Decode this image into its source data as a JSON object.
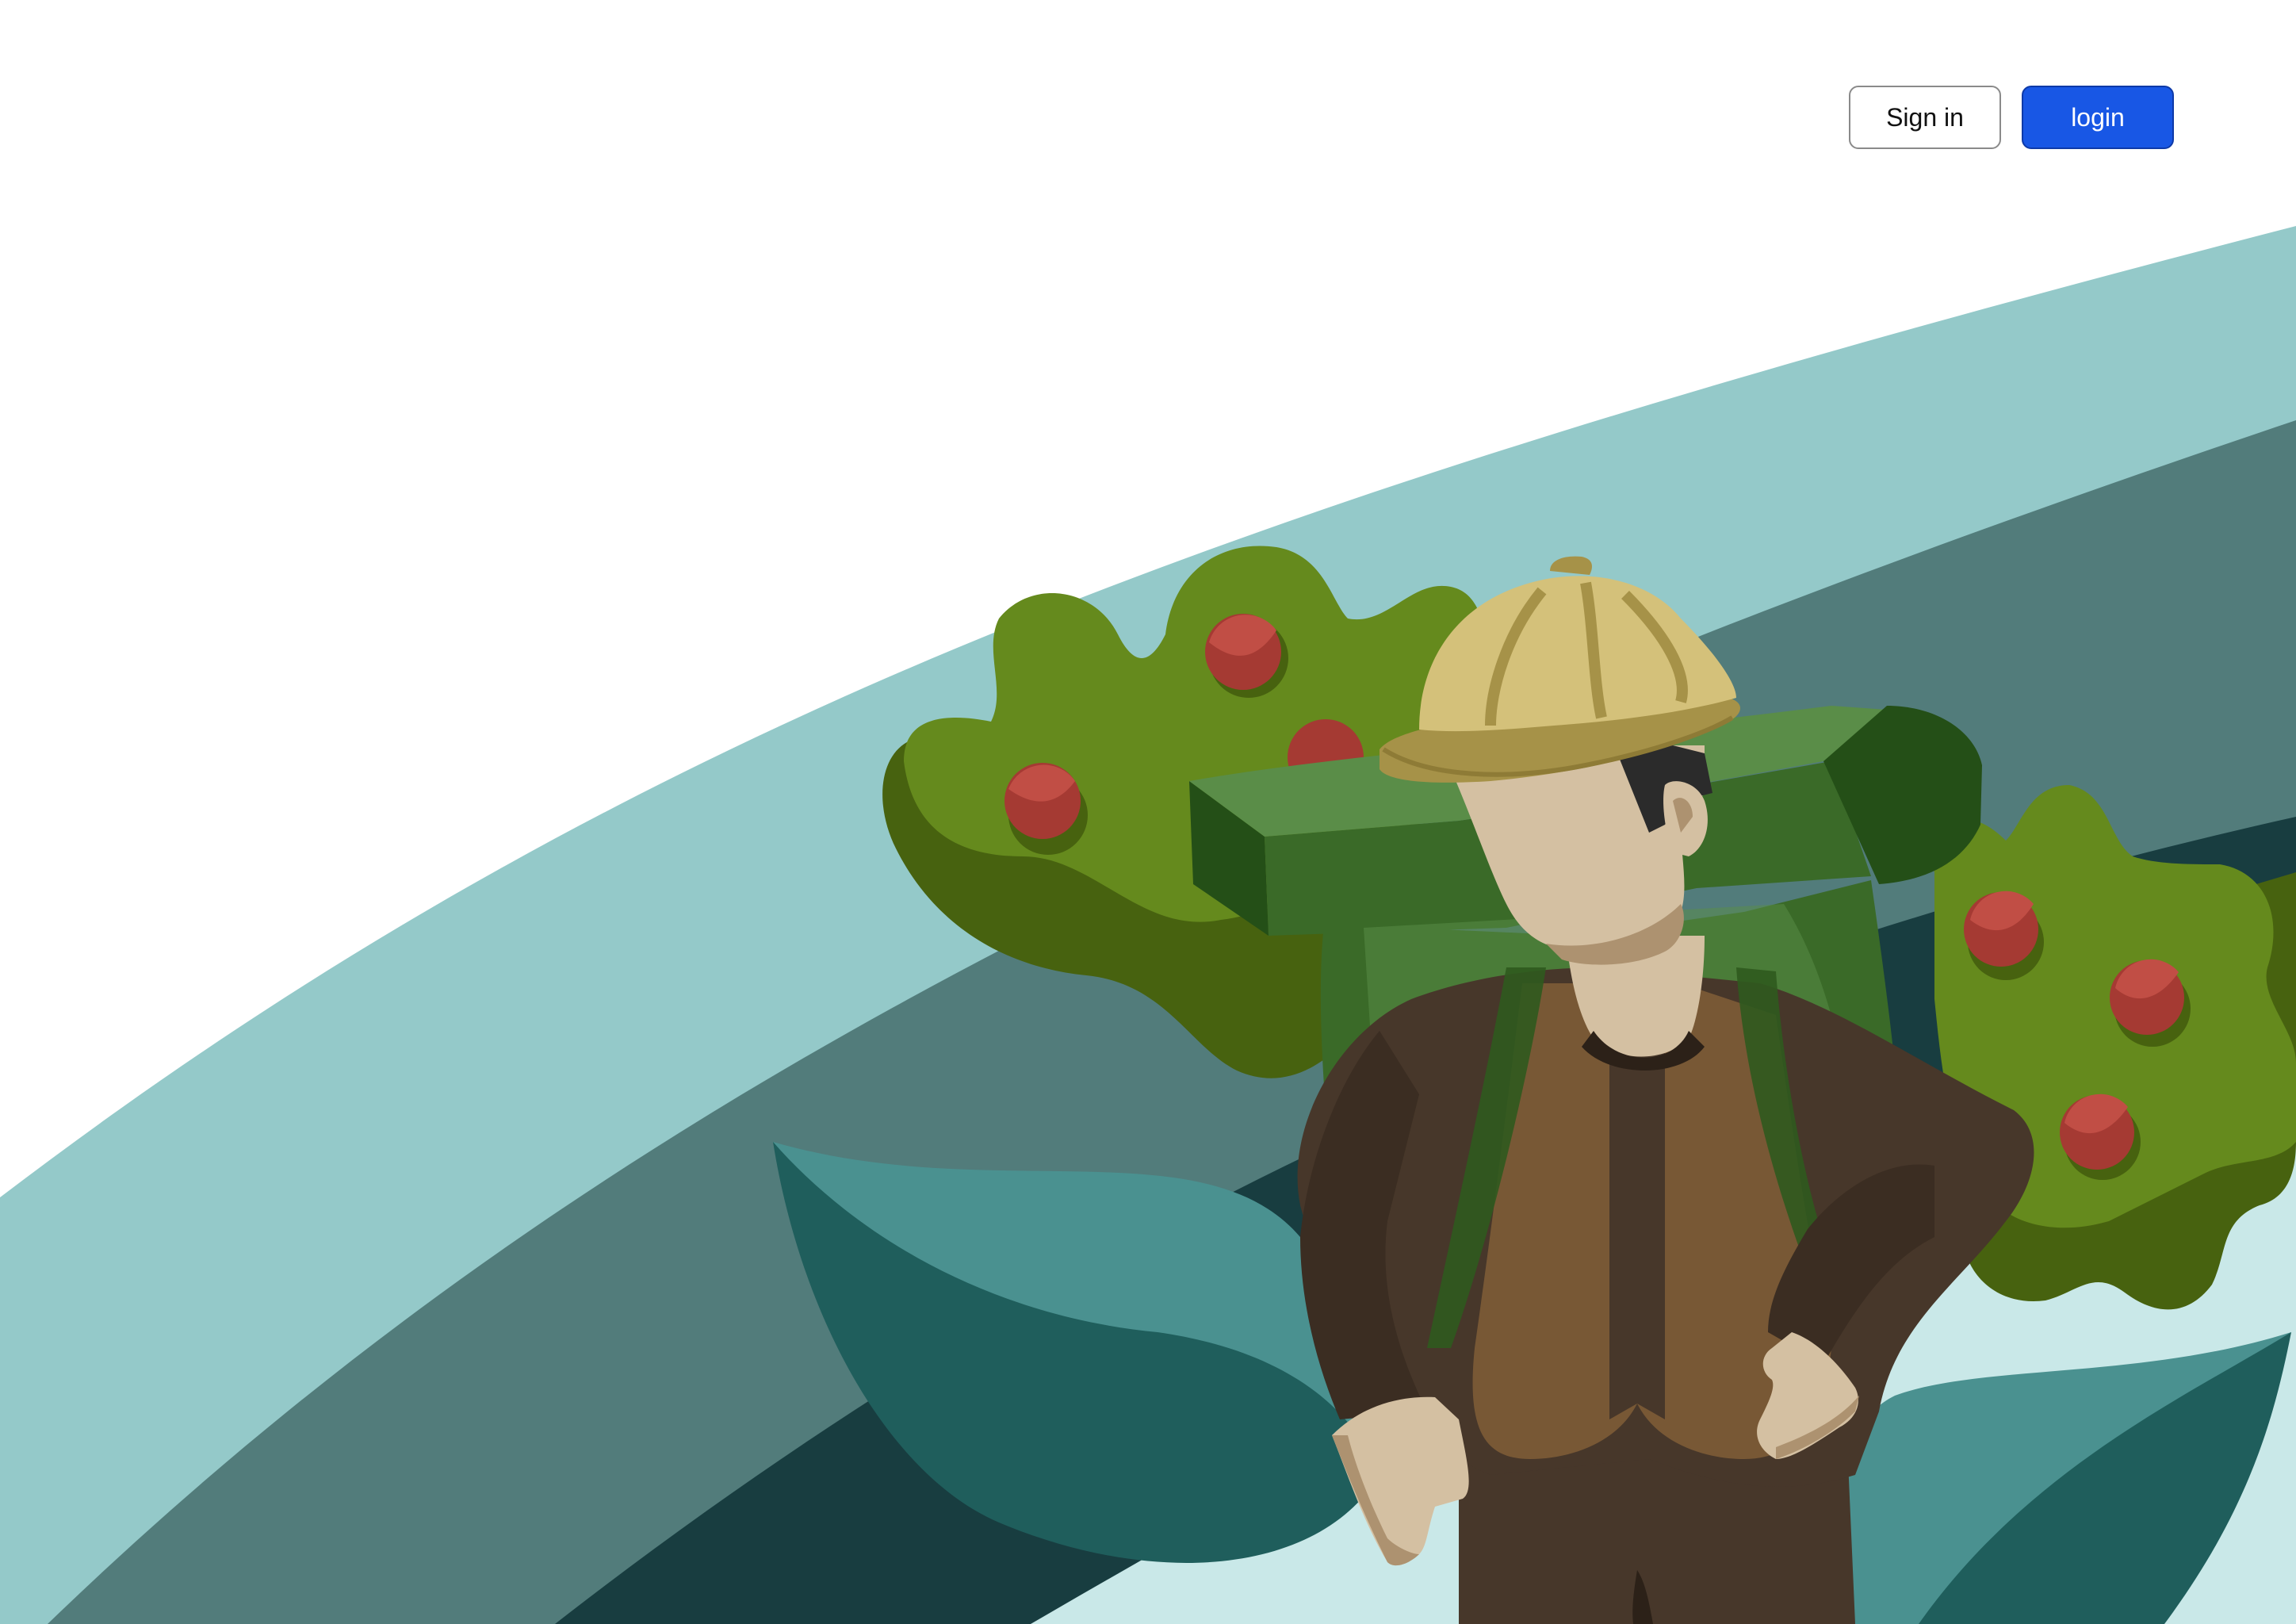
{
  "header": {
    "signin_label": "Sign in",
    "login_label": "login"
  },
  "colors": {
    "primary_button": "#1857e5",
    "outline_button_border": "#8a8a8a",
    "band_light": "#94c9c9",
    "band_mid": "#527c7b",
    "band_dark": "#183d40",
    "ground_light": "#c9e8e8",
    "leaf_dark": "#1f5e5c",
    "leaf_light": "#4a9190",
    "bush_green": "#658a1d",
    "berry_red": "#a53a33"
  },
  "illustration": {
    "subject": "farmer-with-basket"
  }
}
